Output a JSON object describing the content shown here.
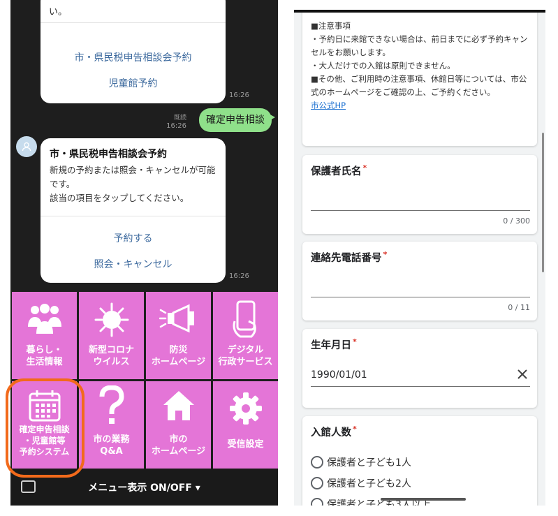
{
  "chat": {
    "top_card": {
      "text_fragment": "い。",
      "links": [
        "市・県民税申告相談会予約",
        "児童館予約"
      ],
      "time": "16:26"
    },
    "sent_message": {
      "text": "確定申告相談",
      "read_label": "既読",
      "time": "16:26"
    },
    "reply_card": {
      "title": "市・県民税申告相談会予約",
      "body": "新規の予約または照会・キャンセルが可能です。\n該当の項目をタップしてください。",
      "actions": [
        "予約する",
        "照会・キャンセル"
      ],
      "time": "16:26"
    }
  },
  "rich_menu": {
    "tiles": [
      {
        "label": "暮らし・\n生活情報",
        "icon": "people-icon"
      },
      {
        "label": "新型コロナ\nウイルス",
        "icon": "virus-icon"
      },
      {
        "label": "防災\nホームページ",
        "icon": "megaphone-icon"
      },
      {
        "label": "デジタル\n行政サービス",
        "icon": "smartphone-icon"
      },
      {
        "label": "確定申告相談\n・児童館等\n予約システム",
        "icon": "calendar-icon"
      },
      {
        "label": "市の業務\nQ&A",
        "icon": "question-icon"
      },
      {
        "label": "市の\nホームページ",
        "icon": "home-icon"
      },
      {
        "label": "受信設定",
        "icon": "gear-icon"
      }
    ],
    "toggle_label": "メニュー表示 ON/OFF ▾",
    "tile_color": "#e475d7",
    "highlight_color": "#f26a1b"
  },
  "form": {
    "notes": {
      "lines": [
        "■注意事項",
        "・予約日に来館できない場合は、前日までに必ず予約キャンセルをお願いします。",
        "・大人だけでの入館は原則できません。",
        "■その他、ご利用時の注意事項、休館日等については、市公式のホームページをご確認の上、ご予約ください。"
      ],
      "link": "市公式HP"
    },
    "fields": {
      "guardian_name": {
        "label": "保護者氏名",
        "required": "*",
        "counter": "0 / 300"
      },
      "phone": {
        "label": "連絡先電話番号",
        "required": "*",
        "counter": "0 / 11"
      },
      "birthdate": {
        "label": "生年月日",
        "required": "*",
        "value": "1990/01/01"
      },
      "visitors": {
        "label": "入館人数",
        "required": "*",
        "options": [
          "保護者と子ども1人",
          "保護者と子ども2人",
          "保護者と子ども3人以上"
        ]
      }
    }
  }
}
